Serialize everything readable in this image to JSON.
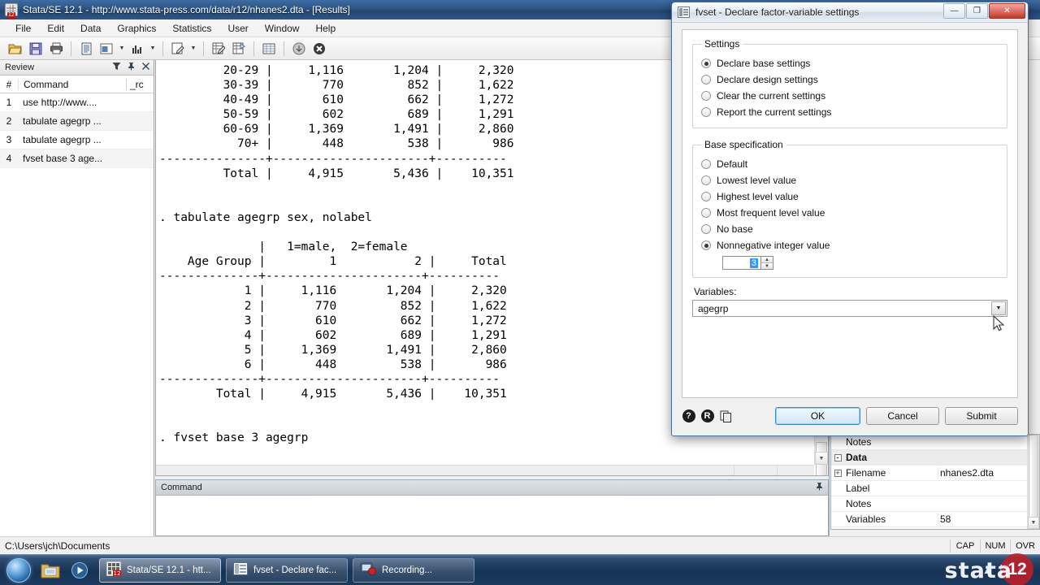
{
  "window": {
    "title": "Stata/SE 12.1 - http://www.stata-press.com/data/r12/nhanes2.dta - [Results]",
    "menu": [
      "File",
      "Edit",
      "Data",
      "Graphics",
      "Statistics",
      "User",
      "Window",
      "Help"
    ]
  },
  "review": {
    "title": "Review",
    "columns": {
      "num": "#",
      "command": "Command",
      "rc": "_rc"
    },
    "rows": [
      {
        "num": "1",
        "command": "use http://www....",
        "rc": ""
      },
      {
        "num": "2",
        "command": "tabulate agegrp ...",
        "rc": ""
      },
      {
        "num": "3",
        "command": "tabulate agegrp ...",
        "rc": ""
      },
      {
        "num": "4",
        "command": "fvset base 3 age...",
        "rc": ""
      }
    ]
  },
  "results": {
    "text": "         20-29 |     1,116       1,204 |     2,320\n         30-39 |       770         852 |     1,622\n         40-49 |       610         662 |     1,272\n         50-59 |       602         689 |     1,291\n         60-69 |     1,369       1,491 |     2,860\n           70+ |       448         538 |       986\n---------------+----------------------+----------\n         Total |     4,915       5,436 |    10,351\n\n\n. tabulate agegrp sex, nolabel\n\n              |   1=male,  2=female\n    Age Group |         1           2 |     Total\n--------------+----------------------+----------\n            1 |     1,116       1,204 |     2,320\n            2 |       770         852 |     1,622\n            3 |       610         662 |     1,272\n            4 |       602         689 |     1,291\n            5 |     1,369       1,491 |     2,860\n            6 |       448         538 |       986\n--------------+----------------------+----------\n        Total |     4,915       5,436 |    10,351\n\n\n. fvset base 3 agegrp\n\n."
  },
  "command_window": {
    "title": "Command",
    "value": "",
    "placeholder": ""
  },
  "properties": {
    "rows": [
      {
        "expand": "",
        "name": "Notes",
        "value": "",
        "section": false
      },
      {
        "expand": "-",
        "name": "Data",
        "value": "",
        "section": true
      },
      {
        "expand": "+",
        "name": "Filename",
        "value": "nhanes2.dta",
        "section": false
      },
      {
        "expand": "",
        "name": "Label",
        "value": "",
        "section": false
      },
      {
        "expand": "",
        "name": "Notes",
        "value": "",
        "section": false
      },
      {
        "expand": "",
        "name": "Variables",
        "value": "58",
        "section": false
      }
    ]
  },
  "statusbar": {
    "path": "C:\\Users\\jch\\Documents",
    "indicators": [
      "CAP",
      "NUM",
      "OVR"
    ]
  },
  "dialog": {
    "title": "fvset - Declare factor-variable settings",
    "window_buttons": {
      "minimize": "—",
      "maximize": "❐",
      "close": "✕"
    },
    "settings": {
      "legend": "Settings",
      "options": [
        {
          "label": "Declare base settings",
          "selected": true
        },
        {
          "label": "Declare design settings",
          "selected": false
        },
        {
          "label": "Clear the current settings",
          "selected": false
        },
        {
          "label": "Report the current settings",
          "selected": false
        }
      ]
    },
    "base_specification": {
      "legend": "Base specification",
      "options": [
        {
          "label": "Default",
          "selected": false
        },
        {
          "label": "Lowest level value",
          "selected": false
        },
        {
          "label": "Highest level value",
          "selected": false
        },
        {
          "label": "Most frequent level value",
          "selected": false
        },
        {
          "label": "No base",
          "selected": false
        },
        {
          "label": "Nonnegative integer value",
          "selected": true
        }
      ],
      "spin_value": "3"
    },
    "variables": {
      "label": "Variables:",
      "value": "agegrp"
    },
    "footer": {
      "icons": [
        "help-icon",
        "reset-icon",
        "copy-icon"
      ],
      "ok": "OK",
      "cancel": "Cancel",
      "submit": "Submit"
    }
  },
  "taskbar": {
    "tasks": [
      {
        "label": "Stata/SE 12.1 - htt...",
        "icon": "stata-icon",
        "active": true
      },
      {
        "label": "fvset - Declare fac...",
        "icon": "dialog-icon",
        "active": false
      },
      {
        "label": "Recording...",
        "icon": "recording-icon",
        "active": false
      }
    ],
    "clock": {
      "time": "",
      "date": ""
    }
  },
  "watermark": {
    "text": "stata",
    "badge": "12"
  },
  "colors": {
    "titlebar": "#2c5484",
    "taskbar": "#173254",
    "accent": "#3c8dc5",
    "selection": "#3399ff",
    "close_button": "#c0392b"
  }
}
